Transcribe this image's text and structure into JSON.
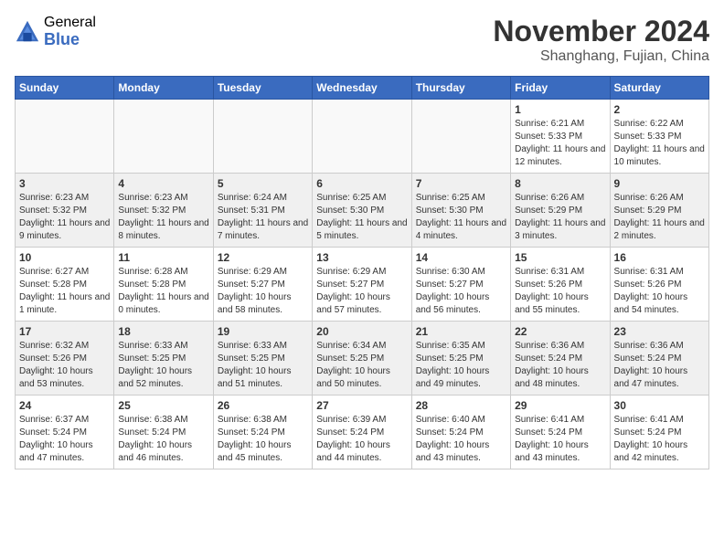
{
  "header": {
    "logo_general": "General",
    "logo_blue": "Blue",
    "month": "November 2024",
    "location": "Shanghang, Fujian, China"
  },
  "weekdays": [
    "Sunday",
    "Monday",
    "Tuesday",
    "Wednesday",
    "Thursday",
    "Friday",
    "Saturday"
  ],
  "weeks": [
    {
      "shaded": false,
      "days": [
        {
          "num": "",
          "info": ""
        },
        {
          "num": "",
          "info": ""
        },
        {
          "num": "",
          "info": ""
        },
        {
          "num": "",
          "info": ""
        },
        {
          "num": "",
          "info": ""
        },
        {
          "num": "1",
          "info": "Sunrise: 6:21 AM\nSunset: 5:33 PM\nDaylight: 11 hours\nand 12 minutes."
        },
        {
          "num": "2",
          "info": "Sunrise: 6:22 AM\nSunset: 5:33 PM\nDaylight: 11 hours\nand 10 minutes."
        }
      ]
    },
    {
      "shaded": true,
      "days": [
        {
          "num": "3",
          "info": "Sunrise: 6:23 AM\nSunset: 5:32 PM\nDaylight: 11 hours\nand 9 minutes."
        },
        {
          "num": "4",
          "info": "Sunrise: 6:23 AM\nSunset: 5:32 PM\nDaylight: 11 hours\nand 8 minutes."
        },
        {
          "num": "5",
          "info": "Sunrise: 6:24 AM\nSunset: 5:31 PM\nDaylight: 11 hours\nand 7 minutes."
        },
        {
          "num": "6",
          "info": "Sunrise: 6:25 AM\nSunset: 5:30 PM\nDaylight: 11 hours\nand 5 minutes."
        },
        {
          "num": "7",
          "info": "Sunrise: 6:25 AM\nSunset: 5:30 PM\nDaylight: 11 hours\nand 4 minutes."
        },
        {
          "num": "8",
          "info": "Sunrise: 6:26 AM\nSunset: 5:29 PM\nDaylight: 11 hours\nand 3 minutes."
        },
        {
          "num": "9",
          "info": "Sunrise: 6:26 AM\nSunset: 5:29 PM\nDaylight: 11 hours\nand 2 minutes."
        }
      ]
    },
    {
      "shaded": false,
      "days": [
        {
          "num": "10",
          "info": "Sunrise: 6:27 AM\nSunset: 5:28 PM\nDaylight: 11 hours\nand 1 minute."
        },
        {
          "num": "11",
          "info": "Sunrise: 6:28 AM\nSunset: 5:28 PM\nDaylight: 11 hours\nand 0 minutes."
        },
        {
          "num": "12",
          "info": "Sunrise: 6:29 AM\nSunset: 5:27 PM\nDaylight: 10 hours\nand 58 minutes."
        },
        {
          "num": "13",
          "info": "Sunrise: 6:29 AM\nSunset: 5:27 PM\nDaylight: 10 hours\nand 57 minutes."
        },
        {
          "num": "14",
          "info": "Sunrise: 6:30 AM\nSunset: 5:27 PM\nDaylight: 10 hours\nand 56 minutes."
        },
        {
          "num": "15",
          "info": "Sunrise: 6:31 AM\nSunset: 5:26 PM\nDaylight: 10 hours\nand 55 minutes."
        },
        {
          "num": "16",
          "info": "Sunrise: 6:31 AM\nSunset: 5:26 PM\nDaylight: 10 hours\nand 54 minutes."
        }
      ]
    },
    {
      "shaded": true,
      "days": [
        {
          "num": "17",
          "info": "Sunrise: 6:32 AM\nSunset: 5:26 PM\nDaylight: 10 hours\nand 53 minutes."
        },
        {
          "num": "18",
          "info": "Sunrise: 6:33 AM\nSunset: 5:25 PM\nDaylight: 10 hours\nand 52 minutes."
        },
        {
          "num": "19",
          "info": "Sunrise: 6:33 AM\nSunset: 5:25 PM\nDaylight: 10 hours\nand 51 minutes."
        },
        {
          "num": "20",
          "info": "Sunrise: 6:34 AM\nSunset: 5:25 PM\nDaylight: 10 hours\nand 50 minutes."
        },
        {
          "num": "21",
          "info": "Sunrise: 6:35 AM\nSunset: 5:25 PM\nDaylight: 10 hours\nand 49 minutes."
        },
        {
          "num": "22",
          "info": "Sunrise: 6:36 AM\nSunset: 5:24 PM\nDaylight: 10 hours\nand 48 minutes."
        },
        {
          "num": "23",
          "info": "Sunrise: 6:36 AM\nSunset: 5:24 PM\nDaylight: 10 hours\nand 47 minutes."
        }
      ]
    },
    {
      "shaded": false,
      "days": [
        {
          "num": "24",
          "info": "Sunrise: 6:37 AM\nSunset: 5:24 PM\nDaylight: 10 hours\nand 47 minutes."
        },
        {
          "num": "25",
          "info": "Sunrise: 6:38 AM\nSunset: 5:24 PM\nDaylight: 10 hours\nand 46 minutes."
        },
        {
          "num": "26",
          "info": "Sunrise: 6:38 AM\nSunset: 5:24 PM\nDaylight: 10 hours\nand 45 minutes."
        },
        {
          "num": "27",
          "info": "Sunrise: 6:39 AM\nSunset: 5:24 PM\nDaylight: 10 hours\nand 44 minutes."
        },
        {
          "num": "28",
          "info": "Sunrise: 6:40 AM\nSunset: 5:24 PM\nDaylight: 10 hours\nand 43 minutes."
        },
        {
          "num": "29",
          "info": "Sunrise: 6:41 AM\nSunset: 5:24 PM\nDaylight: 10 hours\nand 43 minutes."
        },
        {
          "num": "30",
          "info": "Sunrise: 6:41 AM\nSunset: 5:24 PM\nDaylight: 10 hours\nand 42 minutes."
        }
      ]
    }
  ]
}
